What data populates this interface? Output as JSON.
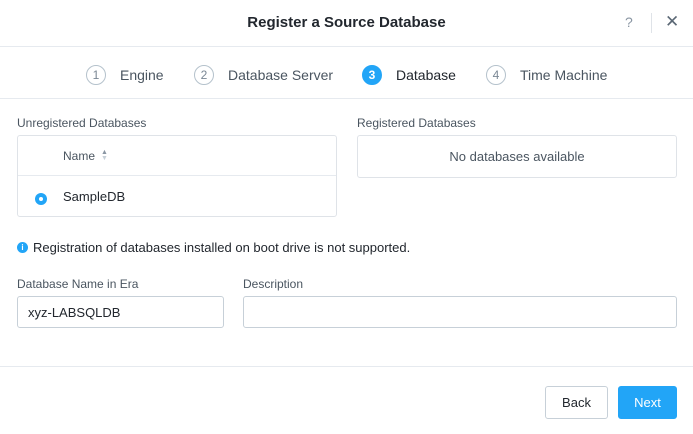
{
  "dialog": {
    "title": "Register a Source Database",
    "help_label": "?",
    "close_label": "✕"
  },
  "steps": [
    {
      "number": "1",
      "label": "Engine",
      "active": false
    },
    {
      "number": "2",
      "label": "Database Server",
      "active": false
    },
    {
      "number": "3",
      "label": "Database",
      "active": true
    },
    {
      "number": "4",
      "label": "Time Machine",
      "active": false
    }
  ],
  "unregistered": {
    "label": "Unregistered Databases",
    "column_header": "Name",
    "rows": [
      {
        "name": "SampleDB",
        "selected": true
      }
    ]
  },
  "registered": {
    "label": "Registered Databases",
    "empty_text": "No databases available"
  },
  "info": {
    "icon": "info-icon",
    "text": "Registration of databases installed on boot drive is not supported."
  },
  "form": {
    "db_name_label": "Database Name in Era",
    "db_name_value": "xyz-LABSQLDB",
    "description_label": "Description",
    "description_value": ""
  },
  "footer": {
    "back_label": "Back",
    "next_label": "Next"
  },
  "colors": {
    "accent": "#22a5f7",
    "border": "#dfe3e8",
    "text": "#22272e"
  }
}
